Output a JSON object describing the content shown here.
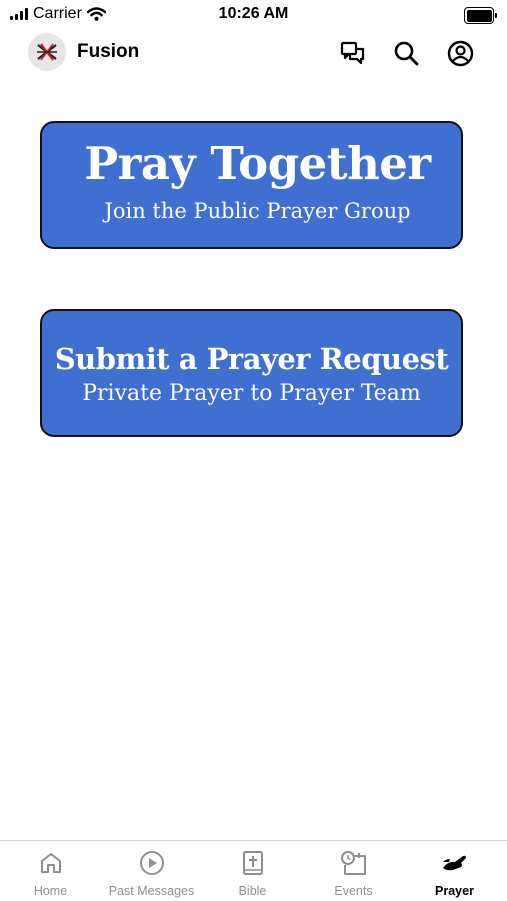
{
  "status_bar": {
    "carrier": "Carrier",
    "time": "10:26 AM"
  },
  "header": {
    "title": "Fusion",
    "icons": [
      "chat-bubbles-icon",
      "search-icon",
      "account-icon"
    ]
  },
  "cards": [
    {
      "title": "Pray Together",
      "subtitle": "Join the Public Prayer Group"
    },
    {
      "title": "Submit a Prayer Request",
      "subtitle": "Private Prayer to Prayer Team"
    }
  ],
  "tab_bar": {
    "tabs": [
      {
        "label": "Home",
        "icon": "home-icon",
        "active": false
      },
      {
        "label": "Past Messages",
        "icon": "play-circle-icon",
        "active": false
      },
      {
        "label": "Bible",
        "icon": "bible-icon",
        "active": false
      },
      {
        "label": "Events",
        "icon": "calendar-clock-icon",
        "active": false
      },
      {
        "label": "Prayer",
        "icon": "praying-hand-icon",
        "active": true
      }
    ]
  },
  "colors": {
    "card_background": "#3f6fd0",
    "card_border": "#111111",
    "inactive_tab": "#8e8e93",
    "active_tab": "#000000"
  }
}
